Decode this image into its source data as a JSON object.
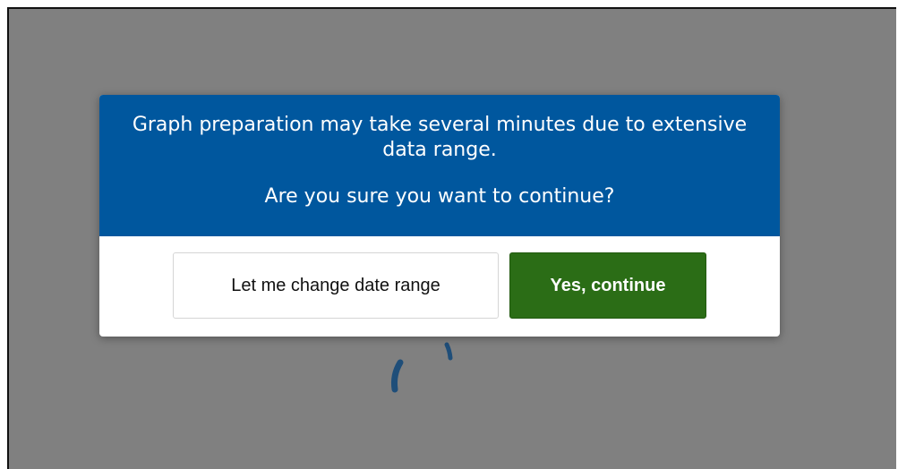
{
  "dialog": {
    "message": "Graph preparation may take several minutes due to extensive data range.",
    "question": "Are you sure you want to continue?",
    "cancel_label": "Let me change date range",
    "confirm_label": "Yes, continue"
  },
  "colors": {
    "overlay": "#808080",
    "header_background": "#00579e",
    "confirm_background": "#2b6d16",
    "spinner": "#1f4e79"
  },
  "icons": {
    "spinner": "loading-spinner-icon"
  }
}
